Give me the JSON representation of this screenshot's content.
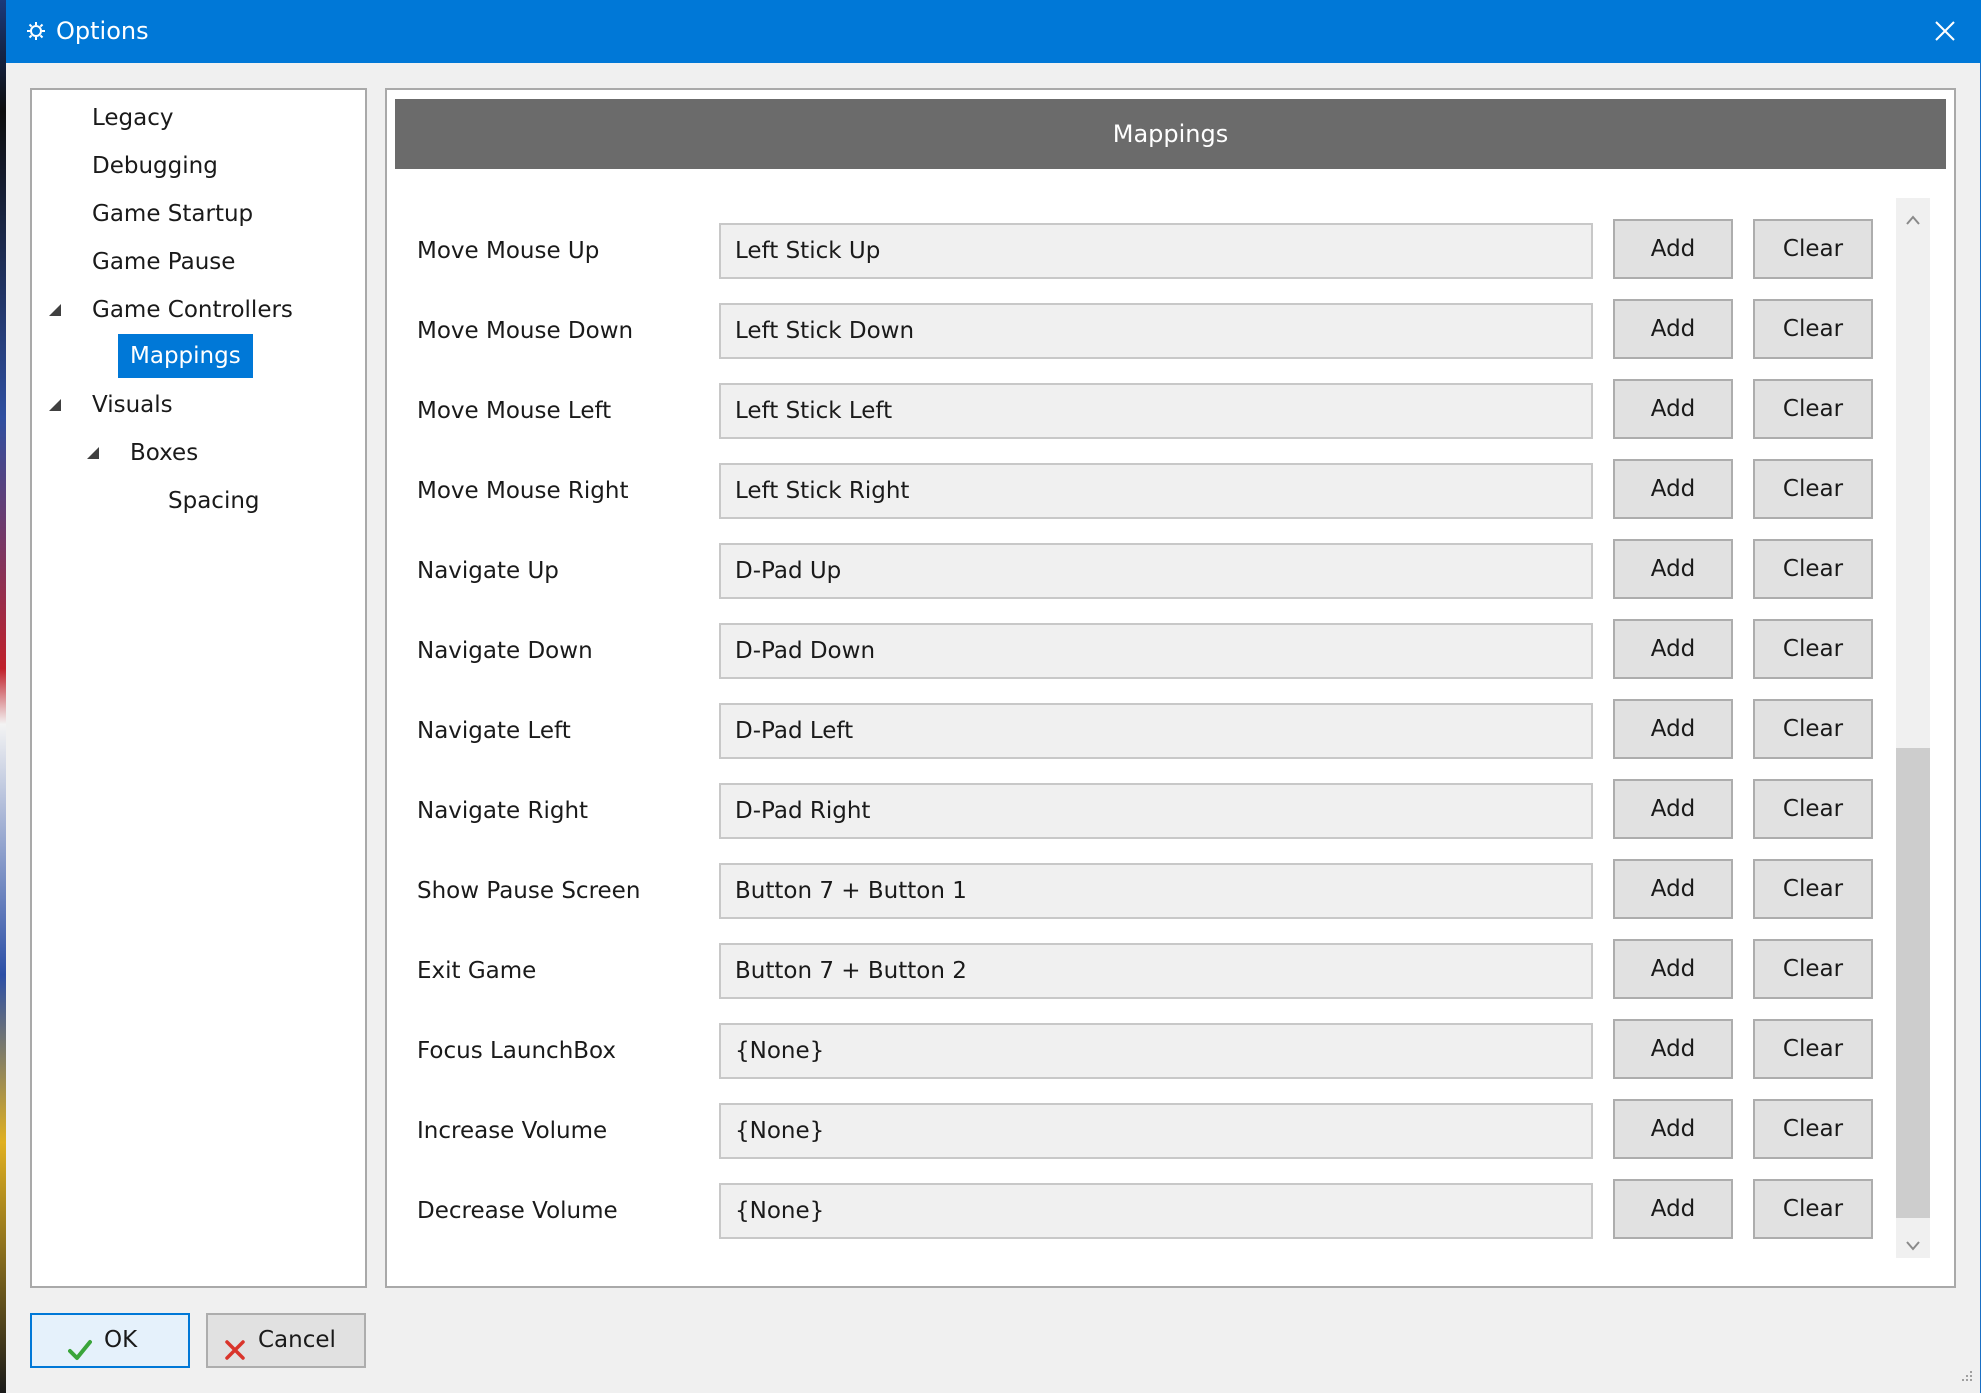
{
  "window": {
    "title": "Options",
    "title_icon": "gear-icon",
    "close_icon": "close-icon",
    "accent_color": "#0078d7"
  },
  "tree": {
    "items": [
      {
        "label": "Legacy"
      },
      {
        "label": "Debugging"
      },
      {
        "label": "Game Startup"
      },
      {
        "label": "Game Pause"
      },
      {
        "label": "Game Controllers",
        "expanded": true
      },
      {
        "label": "Mappings",
        "selected": true
      },
      {
        "label": "Visuals",
        "expanded": true
      },
      {
        "label": "Boxes",
        "expanded": true
      },
      {
        "label": "Spacing"
      }
    ]
  },
  "main": {
    "header": "Mappings",
    "rows": [
      {
        "label": "Move Mouse Up",
        "value": "Left Stick Up",
        "add_label": "Add",
        "clear_label": "Clear"
      },
      {
        "label": "Move Mouse Down",
        "value": "Left Stick Down",
        "add_label": "Add",
        "clear_label": "Clear"
      },
      {
        "label": "Move Mouse Left",
        "value": "Left Stick Left",
        "add_label": "Add",
        "clear_label": "Clear"
      },
      {
        "label": "Move Mouse Right",
        "value": "Left Stick Right",
        "add_label": "Add",
        "clear_label": "Clear"
      },
      {
        "label": "Navigate Up",
        "value": "D-Pad Up",
        "add_label": "Add",
        "clear_label": "Clear"
      },
      {
        "label": "Navigate Down",
        "value": "D-Pad Down",
        "add_label": "Add",
        "clear_label": "Clear"
      },
      {
        "label": "Navigate Left",
        "value": "D-Pad Left",
        "add_label": "Add",
        "clear_label": "Clear"
      },
      {
        "label": "Navigate Right",
        "value": "D-Pad Right",
        "add_label": "Add",
        "clear_label": "Clear"
      },
      {
        "label": "Show Pause Screen",
        "value": "Button 7 + Button 1",
        "add_label": "Add",
        "clear_label": "Clear"
      },
      {
        "label": "Exit Game",
        "value": "Button 7 + Button 2",
        "add_label": "Add",
        "clear_label": "Clear"
      },
      {
        "label": "Focus LaunchBox",
        "value": "{None}",
        "add_label": "Add",
        "clear_label": "Clear"
      },
      {
        "label": "Increase Volume",
        "value": "{None}",
        "add_label": "Add",
        "clear_label": "Clear"
      },
      {
        "label": "Decrease Volume",
        "value": "{None}",
        "add_label": "Add",
        "clear_label": "Clear"
      }
    ],
    "scrollbar": {
      "position": 0.52
    }
  },
  "footer": {
    "ok_label": "OK",
    "ok_icon": "checkmark-icon",
    "cancel_label": "Cancel",
    "cancel_icon": "x-icon"
  }
}
